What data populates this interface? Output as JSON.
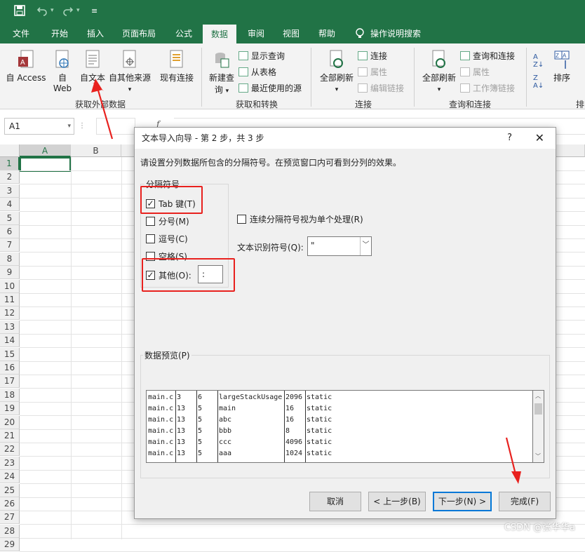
{
  "qat": {
    "save_icon": "save-icon",
    "undo_icon": "undo-icon",
    "redo_icon": "redo-icon",
    "customize_icon": "customize-icon"
  },
  "tabs": [
    "文件",
    "开始",
    "插入",
    "页面布局",
    "公式",
    "数据",
    "审阅",
    "视图",
    "帮助",
    "操作说明搜索"
  ],
  "ribbon": {
    "get_external": {
      "access": "自 Access",
      "web_line1": "自",
      "web_line2": "Web",
      "text": "自文本",
      "other": "自其他来源",
      "existing": "现有连接",
      "label": "获取外部数据"
    },
    "get_transform": {
      "new_query_line1": "新建查",
      "new_query_line2": "询",
      "show_queries": "显示查询",
      "from_table": "从表格",
      "recent_sources": "最近使用的源",
      "label": "获取和转换"
    },
    "connections": {
      "refresh_all": "全部刷新",
      "connections": "连接",
      "properties": "属性",
      "edit_links": "编辑链接",
      "label": "连接"
    },
    "queries_connections": {
      "refresh_all": "全部刷新",
      "queries_connections": "查询和连接",
      "properties": "属性",
      "workbook_links": "工作簿链接",
      "label": "查询和连接"
    },
    "sort": {
      "sort": "排序",
      "label_partial": "排"
    }
  },
  "formula_bar": {
    "name_box": "A1",
    "fx": "f"
  },
  "sheet": {
    "columns": [
      "A",
      "B"
    ],
    "rows": [
      "1",
      "2",
      "3",
      "4",
      "5",
      "6",
      "7",
      "8",
      "9",
      "10",
      "11",
      "12",
      "13",
      "14",
      "15",
      "16",
      "17",
      "18",
      "19",
      "20",
      "21",
      "22",
      "23",
      "24",
      "25",
      "26",
      "27",
      "28",
      "29"
    ]
  },
  "dialog": {
    "title": "文本导入向导 - 第 2 步，共 3 步",
    "help": "?",
    "close": "✕",
    "instruction": "请设置分列数据所包含的分隔符号。在预览窗口内可看到分列的效果。",
    "delimiters_label": "分隔符号",
    "delimiters": [
      {
        "label": "Tab 键(T)",
        "checked": true
      },
      {
        "label": "分号(M)",
        "checked": false
      },
      {
        "label": "逗号(C)",
        "checked": false
      },
      {
        "label": "空格(S)",
        "checked": false
      },
      {
        "label": "其他(O):",
        "checked": true
      }
    ],
    "other_value": ":",
    "consecutive_label": "连续分隔符号视为单个处理(R)",
    "consecutive_checked": false,
    "qualifier_label": "文本识别符号(Q):",
    "qualifier_value": "\"",
    "preview_label": "数据预览(P)",
    "preview_rows": [
      [
        "main.c",
        "3",
        "6",
        "largeStackUsage",
        "2096",
        "static"
      ],
      [
        "main.c",
        "13",
        "5",
        "main",
        "16",
        "static"
      ],
      [
        "main.c",
        "13",
        "5",
        "abc",
        "16",
        "static"
      ],
      [
        "main.c",
        "13",
        "5",
        "bbb",
        "8",
        "static"
      ],
      [
        "main.c",
        "13",
        "5",
        "ccc",
        "4096",
        "static"
      ],
      [
        "main.c",
        "13",
        "5",
        "aaa",
        "1024",
        "static"
      ]
    ],
    "buttons": {
      "cancel": "取消",
      "back": "< 上一步(B)",
      "next": "下一步(N) >",
      "finish": "完成(F)"
    }
  },
  "watermark": "CSDN @张华华a",
  "colors": {
    "excel_green": "#217346",
    "annotation_red": "#e8211e",
    "focus_blue": "#0078d7"
  }
}
